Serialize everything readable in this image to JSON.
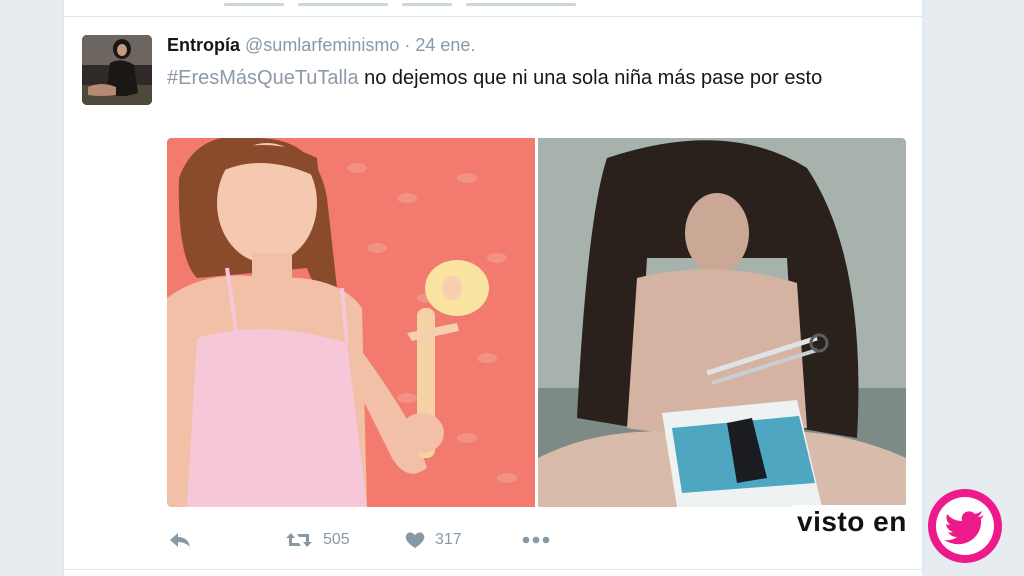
{
  "tweet": {
    "author_name": "Entropía",
    "author_handle": "@sumlarfeminismo",
    "separator": "·",
    "date": "24 ene.",
    "hashtag": "#EresMásQueTuTalla",
    "text": " no dejemos que ni una sola niña más pase por esto"
  },
  "actions": {
    "reply_icon": "reply-icon",
    "retweet_icon": "retweet-icon",
    "retweet_count": "505",
    "like_icon": "heart-icon",
    "like_count": "317",
    "more_icon": "more-dots-icon"
  },
  "watermark": {
    "label": "visto en",
    "logo_icon": "twitter-bird-icon"
  },
  "colors": {
    "hashtag": "#8d99a6",
    "action": "#8899a6",
    "watermark_pink": "#ec1a8a"
  }
}
